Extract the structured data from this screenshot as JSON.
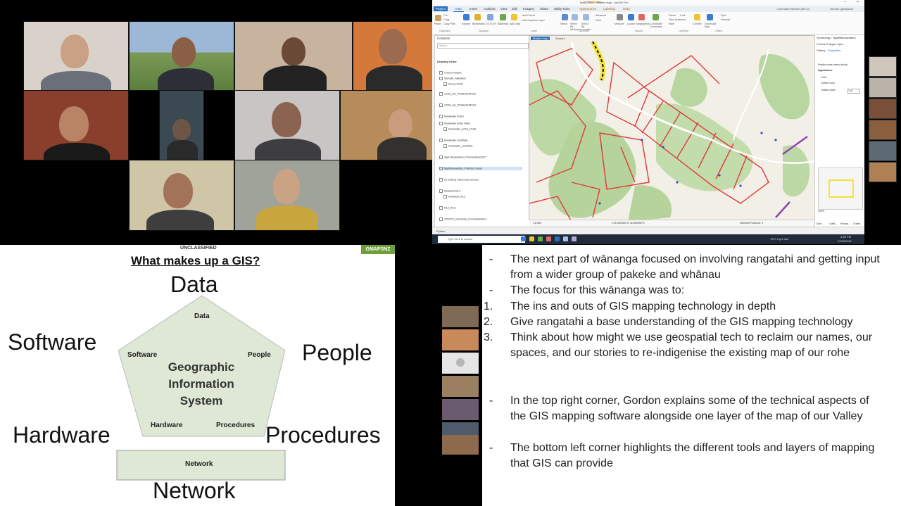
{
  "gis_app": {
    "window_title": "Book_2024 - Master map - ArcGIS Pro",
    "context_tab": "Feature Layer",
    "ribbon_tabs": [
      "Project",
      "Map",
      "Insert",
      "Analysis",
      "View",
      "Edit",
      "Imagery",
      "Share",
      "Utility Tools",
      "Appearance",
      "Labeling",
      "Data"
    ],
    "ribbon_buttons": [
      "Paste",
      "Cut",
      "Copy",
      "Copy Path",
      "Explore",
      "Bookmarks",
      "Go To XY",
      "Basemap",
      "Add Data",
      "Add Preset",
      "Add Graphics Layer",
      "Select",
      "Select By Attributes",
      "Select By Location",
      "Attributes",
      "Clear",
      "Measure",
      "Locate",
      "Infographics",
      "Coordinate Conversion",
      "Pause",
      "Lock",
      "View Unplaced",
      "More",
      "Convert",
      "Download Map",
      "Sync",
      "Remove"
    ],
    "ribbon_groups": [
      "Clipboard",
      "Navigate",
      "Layer",
      "Selection",
      "Inquiry",
      "Labeling",
      "Offline"
    ],
    "search_placeholder": "Command Search (Alt+Q)",
    "user": "Gordon (gmapsnz)",
    "contents_title": "Contents",
    "contents_search": "Search",
    "drawing_order": "Drawing Order",
    "layers": [
      "Contour Heights",
      "Wairoaiti_Valleysites",
      "Survey Points",
      "c2018_wet_VhWalerfieldPoint",
      "c2018_wet_VhWalerfieldPoint",
      "Manawaiko Roads",
      "Manawaiko Active Fields",
      "Manawaiko_Active_Fields",
      "Manawaiko FeatWaka",
      "Manawaiko_FeatWaka",
      "Ngat Manawatahu_ProtectedAreas2017",
      "NgatManawatahu_Protected_Areas",
      "Air building outlines (all sources)",
      "Manawahi MLZ",
      "Manawahi_MLZ",
      "MLZ_block",
      "2021RTU_OpenData_GroundwaterBore"
    ],
    "map_tabs": [
      "Master map",
      "Scene1"
    ],
    "scale": "1:8,500",
    "coordinates": "175.2025351°E 40.453995°S",
    "selected_features": "Selected Features: 0",
    "symbology_title": "Symbology - NgatiManawatahu",
    "symbology_tabs": [
      "Gallery",
      "Properties"
    ],
    "symbology_item": "Format Polygon Sym...",
    "symbology_fields": [
      "Enable scale-based sizing",
      "Appearance",
      "Color",
      "Outline color",
      "Outline width"
    ],
    "outline_width": "1 pt",
    "python_label": "Python",
    "taskbar_search": "Type here to search",
    "weather": "13°C Light rain",
    "clock": "3:46 PM",
    "date": "29/06/2021",
    "zoom": "100%",
    "pane_buttons": [
      "Sym...",
      "Label...",
      "Recept...",
      "Create..."
    ]
  },
  "slide": {
    "classification": "UNCLASSIFIED",
    "badge": "GMAPSNZ",
    "title": "What makes up a GIS?",
    "outer_labels": {
      "data": "Data",
      "software": "Software",
      "people": "People",
      "hardware": "Hardware",
      "procedures": "Procedures",
      "network": "Network"
    },
    "inner_labels": {
      "data": "Data",
      "software": "Software",
      "people": "People",
      "hardware": "Hardware",
      "procedures": "Procedures",
      "network": "Network"
    },
    "center_lines": [
      "Geographic",
      "Information",
      "System"
    ],
    "colors": {
      "pentagon_fill": "#dfe8d4",
      "badge_bg": "#6e9f3a"
    }
  },
  "notes": {
    "bullets_top": [
      "The next part of wānanga focused on involving rangatahi and getting input from a wider group of pakeke and whānau",
      "The focus for this wānanga was to:"
    ],
    "numbered": [
      "The ins and outs of GIS mapping technology in depth",
      "Give rangatahi a base understanding of the GIS mapping technology",
      "Think about how might we use geospatial tech to reclaim our names, our spaces, and our stories to re-indigenise the existing map of our rohe"
    ],
    "numbers": [
      "1.",
      "2.",
      "3."
    ],
    "bullets_bottom": [
      "In the top right corner, Gordon explains some of the technical aspects of the GIS mapping software alongside one layer of the map of our Valley",
      "The bottom left corner highlights the different tools and layers of mapping that GIS can provide"
    ],
    "dash": "-"
  }
}
